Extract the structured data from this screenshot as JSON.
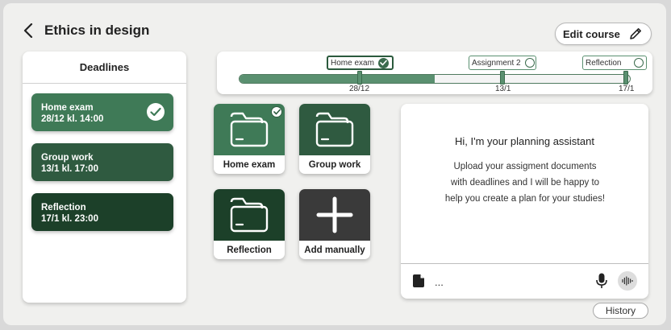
{
  "header": {
    "title": "Ethics in design",
    "edit_course_label": "Edit course"
  },
  "deadlines": {
    "title": "Deadlines",
    "items": [
      {
        "name": "Home exam",
        "when": "28/12 kl. 14:00",
        "done": true,
        "color": "#3f7a57"
      },
      {
        "name": "Group work",
        "when": "13/1 kl. 17:00",
        "done": false,
        "color": "#2f5a40"
      },
      {
        "name": "Reflection",
        "when": "17/1 kl. 23:00",
        "done": false,
        "color": "#1c4029"
      }
    ]
  },
  "timeline": {
    "progress_percent": 50,
    "milestones": [
      {
        "label": "Home exam",
        "date": "28/12",
        "done": true
      },
      {
        "label": "Assignment 2",
        "date": "13/1",
        "done": false
      },
      {
        "label": "Reflection",
        "date": "17/1",
        "done": false
      }
    ]
  },
  "tiles": [
    {
      "label": "Home exam",
      "icon": "folder-icon",
      "color": "#3f7a57",
      "checked": true
    },
    {
      "label": "Group work",
      "icon": "folder-icon",
      "color": "#2f5a40",
      "checked": false
    },
    {
      "label": "Reflection",
      "icon": "folder-icon",
      "color": "#1c4029",
      "checked": false
    },
    {
      "label": "Add manually",
      "icon": "plus-icon",
      "color": "#3a3a3a",
      "checked": false
    }
  ],
  "assistant": {
    "title": "Hi, I'm your planning assistant",
    "body": "Upload your assigment documents with deadlines and I will be happy to help you create a plan for your studies!",
    "input_placeholder": "..."
  },
  "history_label": "History"
}
